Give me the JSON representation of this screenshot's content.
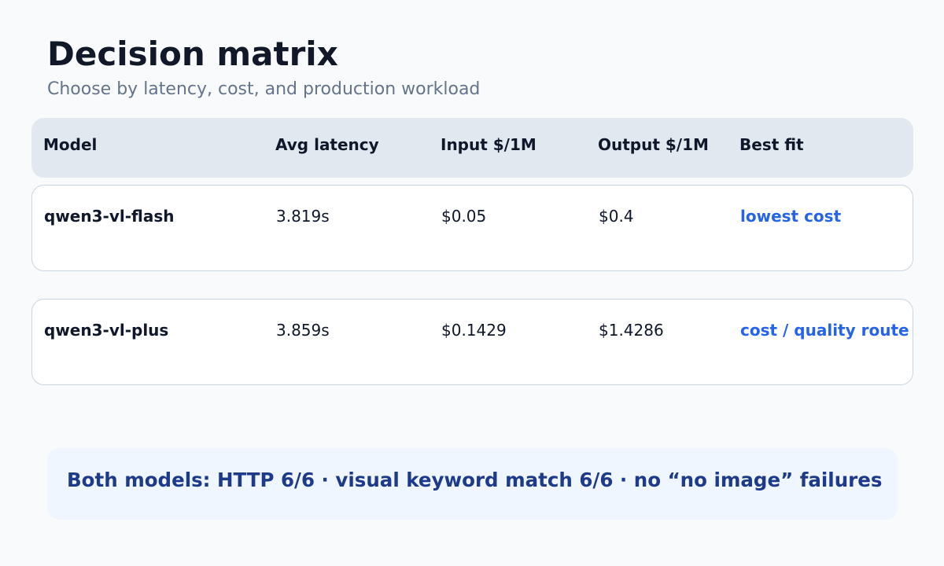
{
  "page": {
    "title": "Decision matrix",
    "subtitle": "Choose by latency, cost, and production workload"
  },
  "table": {
    "headers": {
      "model": "Model",
      "latency": "Avg latency",
      "input": "Input $/1M",
      "output": "Output $/1M",
      "fit": "Best fit"
    },
    "rows": [
      {
        "model": "qwen3-vl-flash",
        "latency": "3.819s",
        "input": "$0.05",
        "output": "$0.4",
        "fit": "lowest cost"
      },
      {
        "model": "qwen3-vl-plus",
        "latency": "3.859s",
        "input": "$0.1429",
        "output": "$1.4286",
        "fit": "cost / quality route"
      }
    ]
  },
  "summary": {
    "text": "Both models: HTTP 6/6 · visual keyword match 6/6 · no “no image” failures"
  },
  "colors": {
    "background": "#f8fafc",
    "header_bg": "#e2e8f0",
    "accent": "#2563eb",
    "summary_bg": "#eff6ff",
    "summary_text": "#1e3a8a"
  }
}
